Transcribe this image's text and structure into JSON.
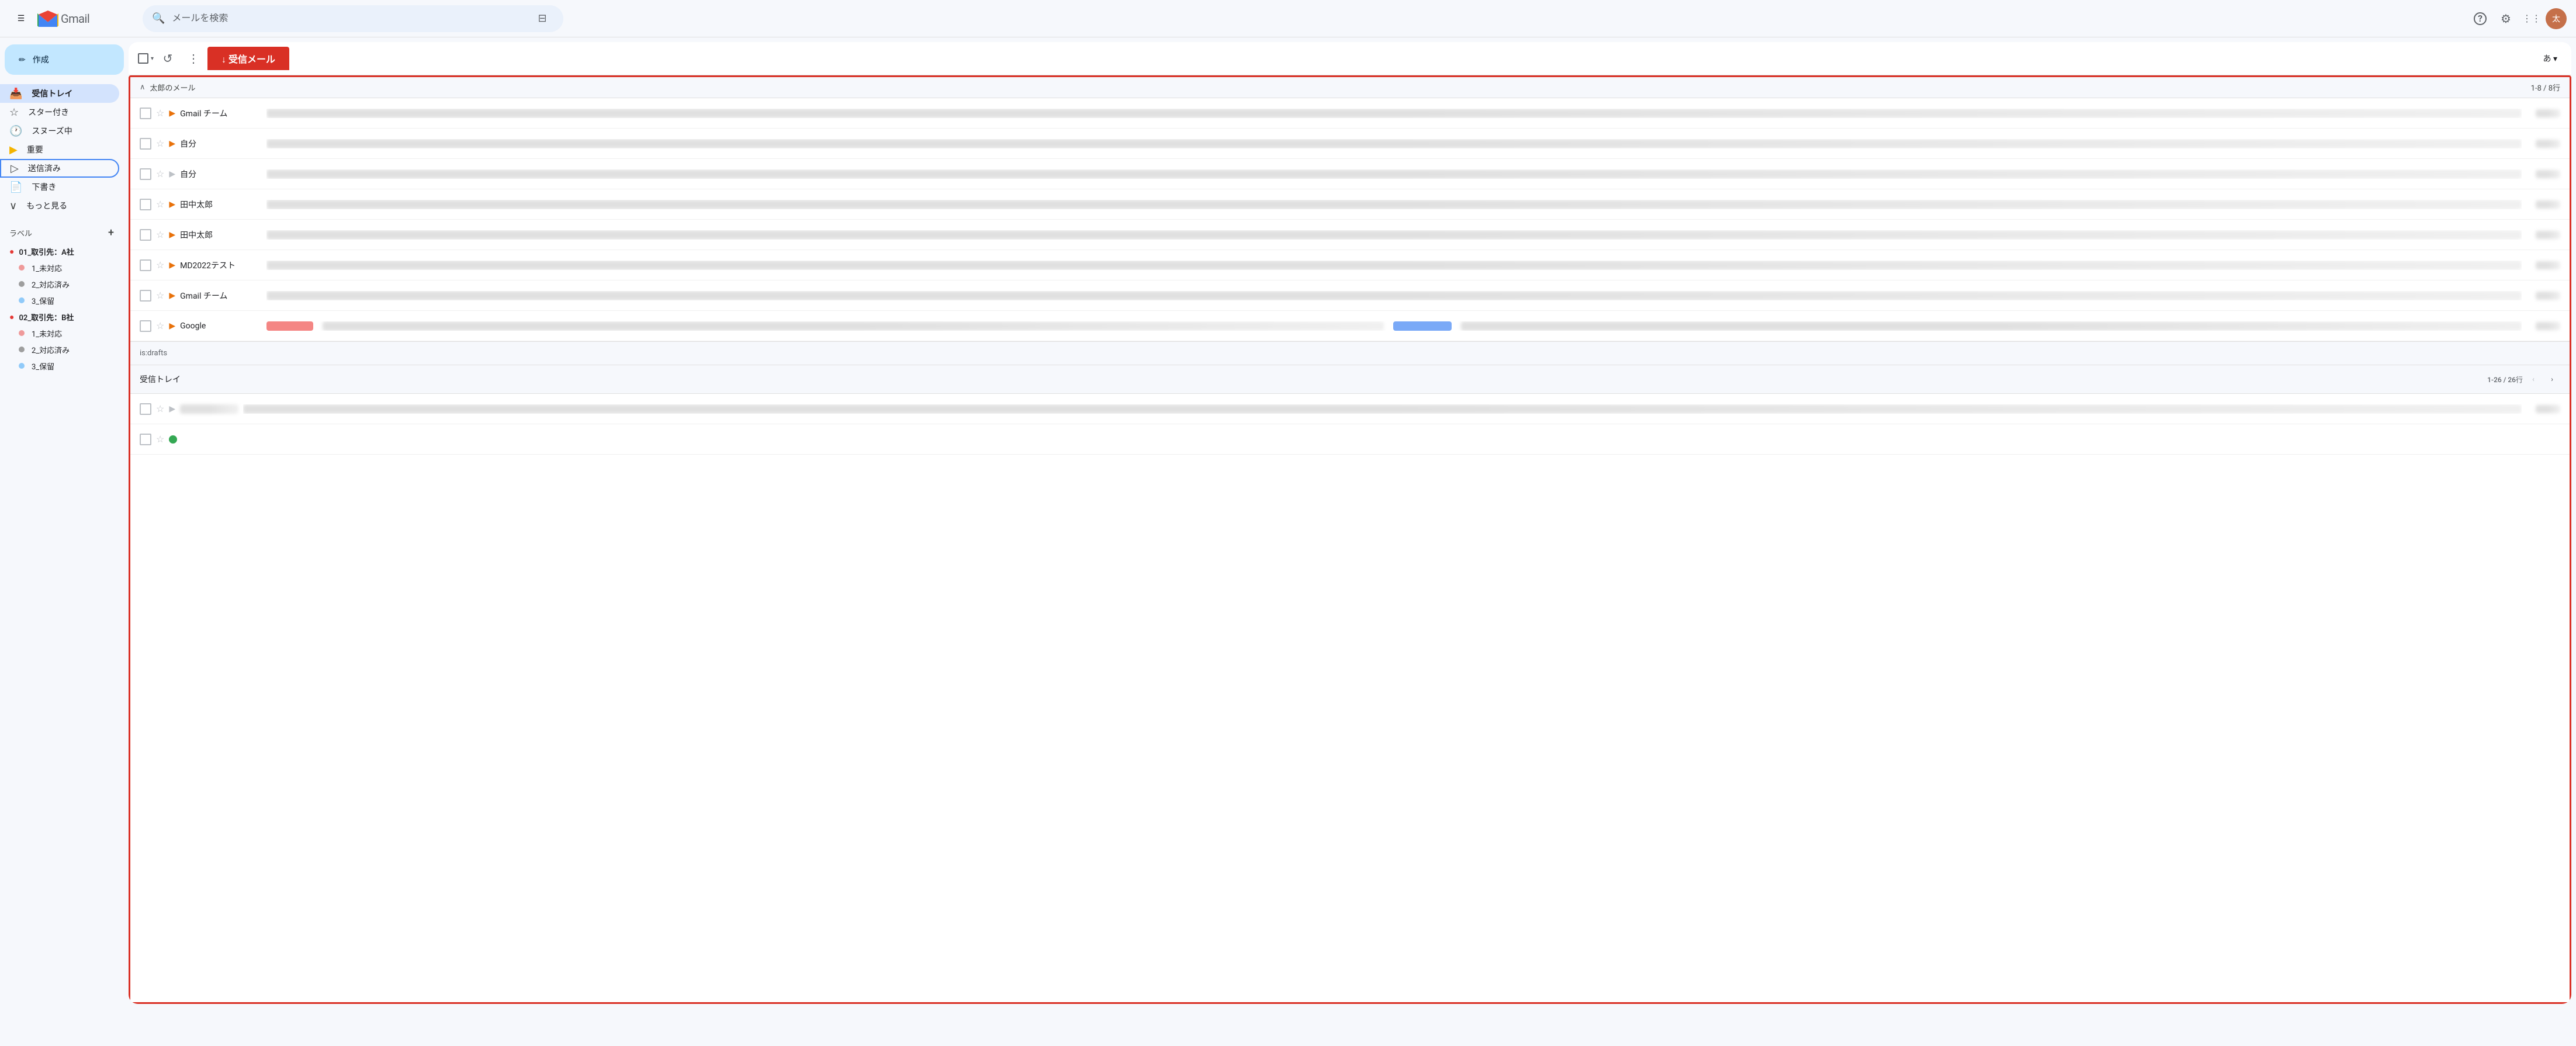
{
  "topbar": {
    "search_placeholder": "メールを検索",
    "gmail_label": "Gmail"
  },
  "sidebar": {
    "compose_label": "作成",
    "nav_items": [
      {
        "id": "inbox",
        "label": "受信トレイ",
        "icon": "📥",
        "active": true
      },
      {
        "id": "starred",
        "label": "スター付き",
        "icon": "☆"
      },
      {
        "id": "snoozed",
        "label": "スヌーズ中",
        "icon": "🕐"
      },
      {
        "id": "important",
        "label": "重要",
        "icon": "🏷"
      },
      {
        "id": "sent",
        "label": "送信済み",
        "icon": "▷",
        "selected_outline": true
      },
      {
        "id": "drafts",
        "label": "下書き",
        "icon": "📄"
      },
      {
        "id": "more",
        "label": "もっと見る",
        "icon": "∨"
      }
    ],
    "labels_header": "ラベル",
    "labels": [
      {
        "id": "01_a",
        "label": "01_取引先：A社",
        "color": "#e53935",
        "is_group": true
      },
      {
        "id": "01_a_1",
        "label": "1_未対応",
        "color": "#ef9a9a",
        "indent": true
      },
      {
        "id": "01_a_2",
        "label": "2_対応済み",
        "color": "#9e9e9e",
        "indent": true
      },
      {
        "id": "01_a_3",
        "label": "3_保留",
        "color": "#90caf9",
        "indent": true
      },
      {
        "id": "02_b",
        "label": "02_取引先：B社",
        "color": "#e53935",
        "is_group": true
      },
      {
        "id": "02_b_1",
        "label": "1_未対応",
        "color": "#ef9a9a",
        "indent": true
      },
      {
        "id": "02_b_2",
        "label": "2_対応済み",
        "color": "#9e9e9e",
        "indent": true
      },
      {
        "id": "02_b_3",
        "label": "3_保留",
        "color": "#90caf9",
        "indent": true
      }
    ]
  },
  "inbox_tab": {
    "label": "↓ 受信メール",
    "user_label": "あ ▾"
  },
  "taro_section": {
    "title": "太郎のメール",
    "count": "1-8 / 8行",
    "emails": [
      {
        "id": 1,
        "sender": "Gmail チーム",
        "subject": "xxxxxxxxxxxxxxx",
        "preview": "xxxxxxxxxxxxxxxxxxxxxxxxxxxxxxxxxxxxxxxxxxxxxxxxxxxxxxxxxxxxx",
        "date": "xxxxxxx",
        "starred": false,
        "label_color": "orange"
      },
      {
        "id": 2,
        "sender": "自分",
        "subject": "xxxxxxx",
        "preview": "xxxxxxxxxxxxxx",
        "date": "xxxxxxx",
        "starred": false,
        "label_color": "orange"
      },
      {
        "id": 3,
        "sender": "自分",
        "subject": "xxxxxxx",
        "preview": "xxxxxxxxxxxxxx",
        "date": "xxxxxxx",
        "starred": false,
        "label_color": "none"
      },
      {
        "id": 4,
        "sender": "田中太郎",
        "subject": "xxxxxxx",
        "preview": "xxxxxxxxxxxxxxxxxxxxxxxxxxxxxxxxxxxxxxxxx",
        "date": "xxxxxxx",
        "starred": false,
        "label_color": "orange"
      },
      {
        "id": 5,
        "sender": "田中太郎",
        "subject": "xxxxxxx",
        "preview": "xxxxxxxxxxxxxxxxxxxxxxxxxxxxxxxxxxxxxxxxxxxxxxxxxxxxxxx",
        "date": "xxxxxxx",
        "starred": false,
        "label_color": "orange"
      },
      {
        "id": 6,
        "sender": "MD2022テスト",
        "subject": "xxxxxxx",
        "preview": "xxxxxxxxxxxxxxxxxxxxxxxxxxxxxxxxxxxx",
        "date": "xxxxxxx",
        "starred": false,
        "label_color": "orange"
      },
      {
        "id": 7,
        "sender": "Gmail チーム",
        "subject": "xxxxxxx",
        "preview": "xxxxxxxxxxxxxxxxxxxxxxxxxxxxxxxxxxxxxxxxxxxxxxxxxxxxxxxxxxxxxxxxxxxxxxxxxxxxxxxx",
        "date": "xxxxxxx",
        "starred": false,
        "label_color": "orange"
      },
      {
        "id": 8,
        "sender": "Google",
        "subject": "",
        "preview": "xxxxxxxxxxxxxxxxxxxxxxxxxxxxxxxx",
        "date": "xxxxxxx",
        "starred": false,
        "label_color": "orange",
        "has_color_blobs": true,
        "blob1": "#ef5350",
        "blob2": "#4285f4"
      }
    ]
  },
  "drafts_section": {
    "label": "is:drafts"
  },
  "inbox_section": {
    "title": "受信トレイ",
    "count": "1-26 / 26行",
    "emails": [
      {
        "id": 1,
        "sender": "xxxxxxxx",
        "subject": "xxxxxxxxxxxxxxxxxxxxxxxxxxxxxxxxxxxxxxxxxxxxxxx",
        "preview": "xxxxxxxxxxxxxxxxxxxxxxxxxxxxxxxxxxxxxxxxxxxxxxx",
        "date": "xxxxxxx",
        "starred": false,
        "label_color": "gray",
        "has_green_dot": false
      },
      {
        "id": 2,
        "sender": "",
        "subject": "",
        "preview": "",
        "date": "",
        "has_green_dot": true
      }
    ]
  },
  "icons": {
    "hamburger": "☰",
    "search": "🔍",
    "filter": "⊟",
    "help": "?",
    "settings": "⚙",
    "apps": "⋮⋮",
    "chevron_down": "▾",
    "collapse": "∧",
    "pencil": "✏",
    "refresh": "↺",
    "more_vert": "⋮",
    "arrow_left": "‹",
    "arrow_right": "›"
  },
  "colors": {
    "active_nav": "#d3e3fd",
    "compose_bg": "#c2e7ff",
    "inbox_tab_bg": "#d93025",
    "red_outline": "#d93025",
    "accent_blue": "#4285f4"
  }
}
